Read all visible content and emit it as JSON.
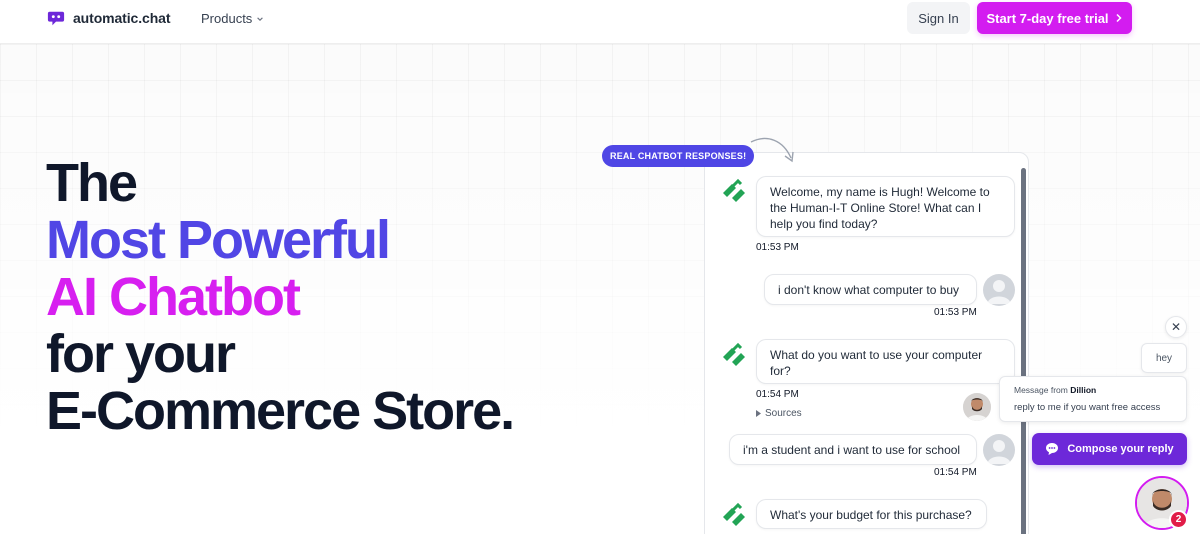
{
  "colors": {
    "brand_pink": "#d31cf0",
    "brand_blue": "#5146e5",
    "dark": "#0f172a",
    "bot_green": "#22a455",
    "compose_purple": "#6d28d9"
  },
  "nav": {
    "logo_text": "automatic.chat",
    "logo_icon": "chat-bubble-logo-icon",
    "products_label": "Products",
    "signin_label": "Sign In",
    "trial_label": "Start 7-day free trial"
  },
  "hero": {
    "line1": "The",
    "line2": "Most Powerful",
    "line3": "AI Chatbot",
    "line4": "for your",
    "line5": "E-Commerce Store."
  },
  "demo": {
    "badge": "REAL CHATBOT RESPONSES!",
    "messages": [
      {
        "from": "bot",
        "text": "Welcome, my name is Hugh! Welcome to the Human-I-T Online Store! What can I help you find today?",
        "time": "01:53 PM"
      },
      {
        "from": "user",
        "text": "i don't know what computer to buy",
        "time": "01:53 PM"
      },
      {
        "from": "bot",
        "text": "What do you want to use your computer for?",
        "time": "01:54 PM",
        "sources": "Sources"
      },
      {
        "from": "user",
        "text": "i'm a student and i want to use for school",
        "time": "01:54 PM"
      },
      {
        "from": "bot",
        "text": "What's your budget for this purchase?"
      }
    ]
  },
  "widget": {
    "close_icon": "close-icon",
    "hey_text": "hey",
    "notif_prefix": "Message from",
    "notif_sender": "Dillion",
    "notif_body": "reply to me if you want free access",
    "compose_label": "Compose your reply",
    "unread_count": "2"
  }
}
